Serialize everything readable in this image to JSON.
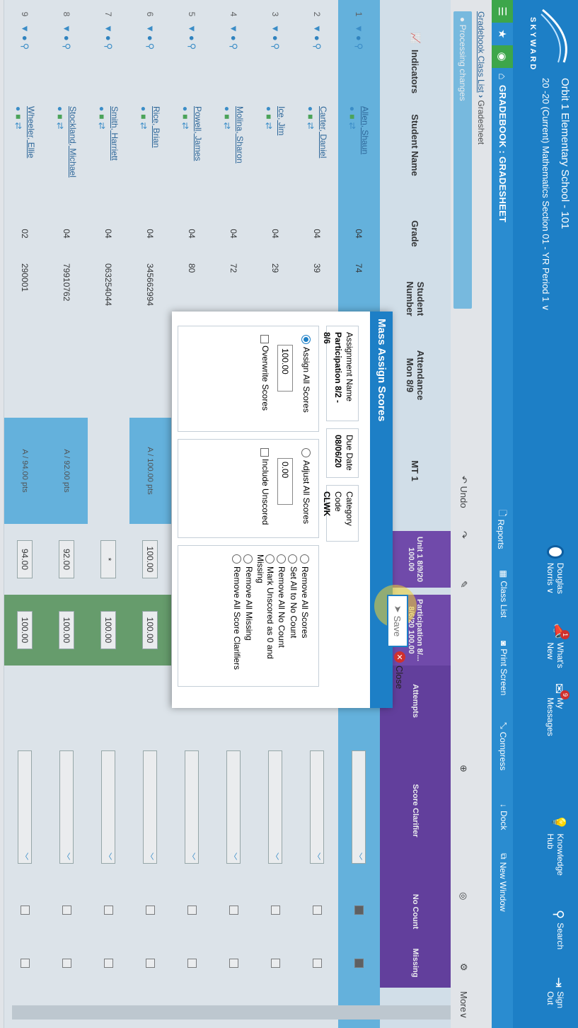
{
  "header": {
    "brand": "SKYWARD",
    "school": "Orbit 1 Elementary School - 101",
    "context": "20 -20 (Current) Mathematics Section 01 - YR Period 1 ∨",
    "user": "Douglas Norris ∨",
    "items": [
      {
        "label": "What's New",
        "badge": "1"
      },
      {
        "label": "My Messages",
        "badge": "9"
      },
      {
        "label": "Knowledge Hub"
      },
      {
        "label": "Search"
      },
      {
        "label": "Sign Out"
      }
    ]
  },
  "quickbar": {
    "title": "GRADEBOOK : GRADESHEET",
    "tools": [
      "Reports",
      "Class List",
      "Print Screen",
      "Compress",
      "Dock",
      "New Window"
    ]
  },
  "breadcrumb": [
    "Gradebook Class List",
    "Gradesheet"
  ],
  "processing": "Processing changes",
  "actions": {
    "undo": "Undo",
    "more": "More∨"
  },
  "columns": {
    "indicators": "Indicators",
    "student": "Student Name",
    "grade": "Grade",
    "number": "Student Number",
    "attendance": "Attendance Mon 8/9",
    "mt1": "MT 1",
    "unit1": "Unit 1 8/9/20 100.00",
    "particip": "Participation 8/... 8/6/20 100.00",
    "attempts": "Attempts",
    "clarifier": "Score Clarifier",
    "nocount": "No Count",
    "missing": "Missing"
  },
  "rows": [
    {
      "n": "1",
      "name": "Allen, Shaun",
      "grade": "04",
      "number": "74",
      "mt": "",
      "u1": "",
      "p8": ""
    },
    {
      "n": "2",
      "name": "Carter, Daniel",
      "grade": "04",
      "number": "39",
      "mt": "",
      "u1": "",
      "p8": ""
    },
    {
      "n": "3",
      "name": "Ice, Jim",
      "grade": "04",
      "number": "29",
      "mt": "",
      "u1": "",
      "p8": ""
    },
    {
      "n": "4",
      "name": "Molina, Sharon",
      "grade": "04",
      "number": "72",
      "mt": "",
      "u1": "",
      "p8": ""
    },
    {
      "n": "5",
      "name": "Powell, James",
      "grade": "04",
      "number": "80",
      "mt": "",
      "u1": "",
      "p8": ""
    },
    {
      "n": "6",
      "name": "Rice, Brian",
      "grade": "04",
      "number": "345662994",
      "mt": "A / 100.00 pts",
      "u1": "100.00",
      "p8": "100.00"
    },
    {
      "n": "7",
      "name": "Smith, Harriett",
      "grade": "04",
      "number": "063254044",
      "mt": "",
      "u1": "*",
      "p8": "100.00"
    },
    {
      "n": "8",
      "name": "Stockland, Michael",
      "grade": "04",
      "number": "79910762",
      "mt": "A / 92.00 pts",
      "u1": "92.00",
      "p8": "100.00"
    },
    {
      "n": "9",
      "name": "Wheeler, Ellie",
      "grade": "02",
      "number": "290001",
      "mt": "A / 94.00 pts",
      "u1": "94.00",
      "p8": "100.00"
    }
  ],
  "modal": {
    "title": "Mass Assign Scores",
    "assignment_label": "Assignment Name",
    "assignment_value": "Participation 8/2 - 8/6",
    "due_label": "Due Date",
    "due_value": "08/06/20",
    "category_label": "Category Code",
    "category_value": "CLWK",
    "assign_all": "Assign All Scores",
    "assign_value": "100.00",
    "overwrite": "Overwrite Scores",
    "adjust_all": "Adjust All Scores",
    "adjust_value": "0.00",
    "include_unscored": "Include Unscored",
    "options": [
      "Remove All Scores",
      "Set All to No Count",
      "Remove All No Count",
      "Mark Unscored as 0 and Missing",
      "Remove All Missing",
      "Remove All Score Clarifiers"
    ],
    "save": "Save",
    "close": "Close"
  },
  "colors": {
    "brand": "#1d7fc6",
    "purple": "#6b3aad",
    "green": "#5f9e61",
    "selected_row": "#5cb8ea"
  }
}
